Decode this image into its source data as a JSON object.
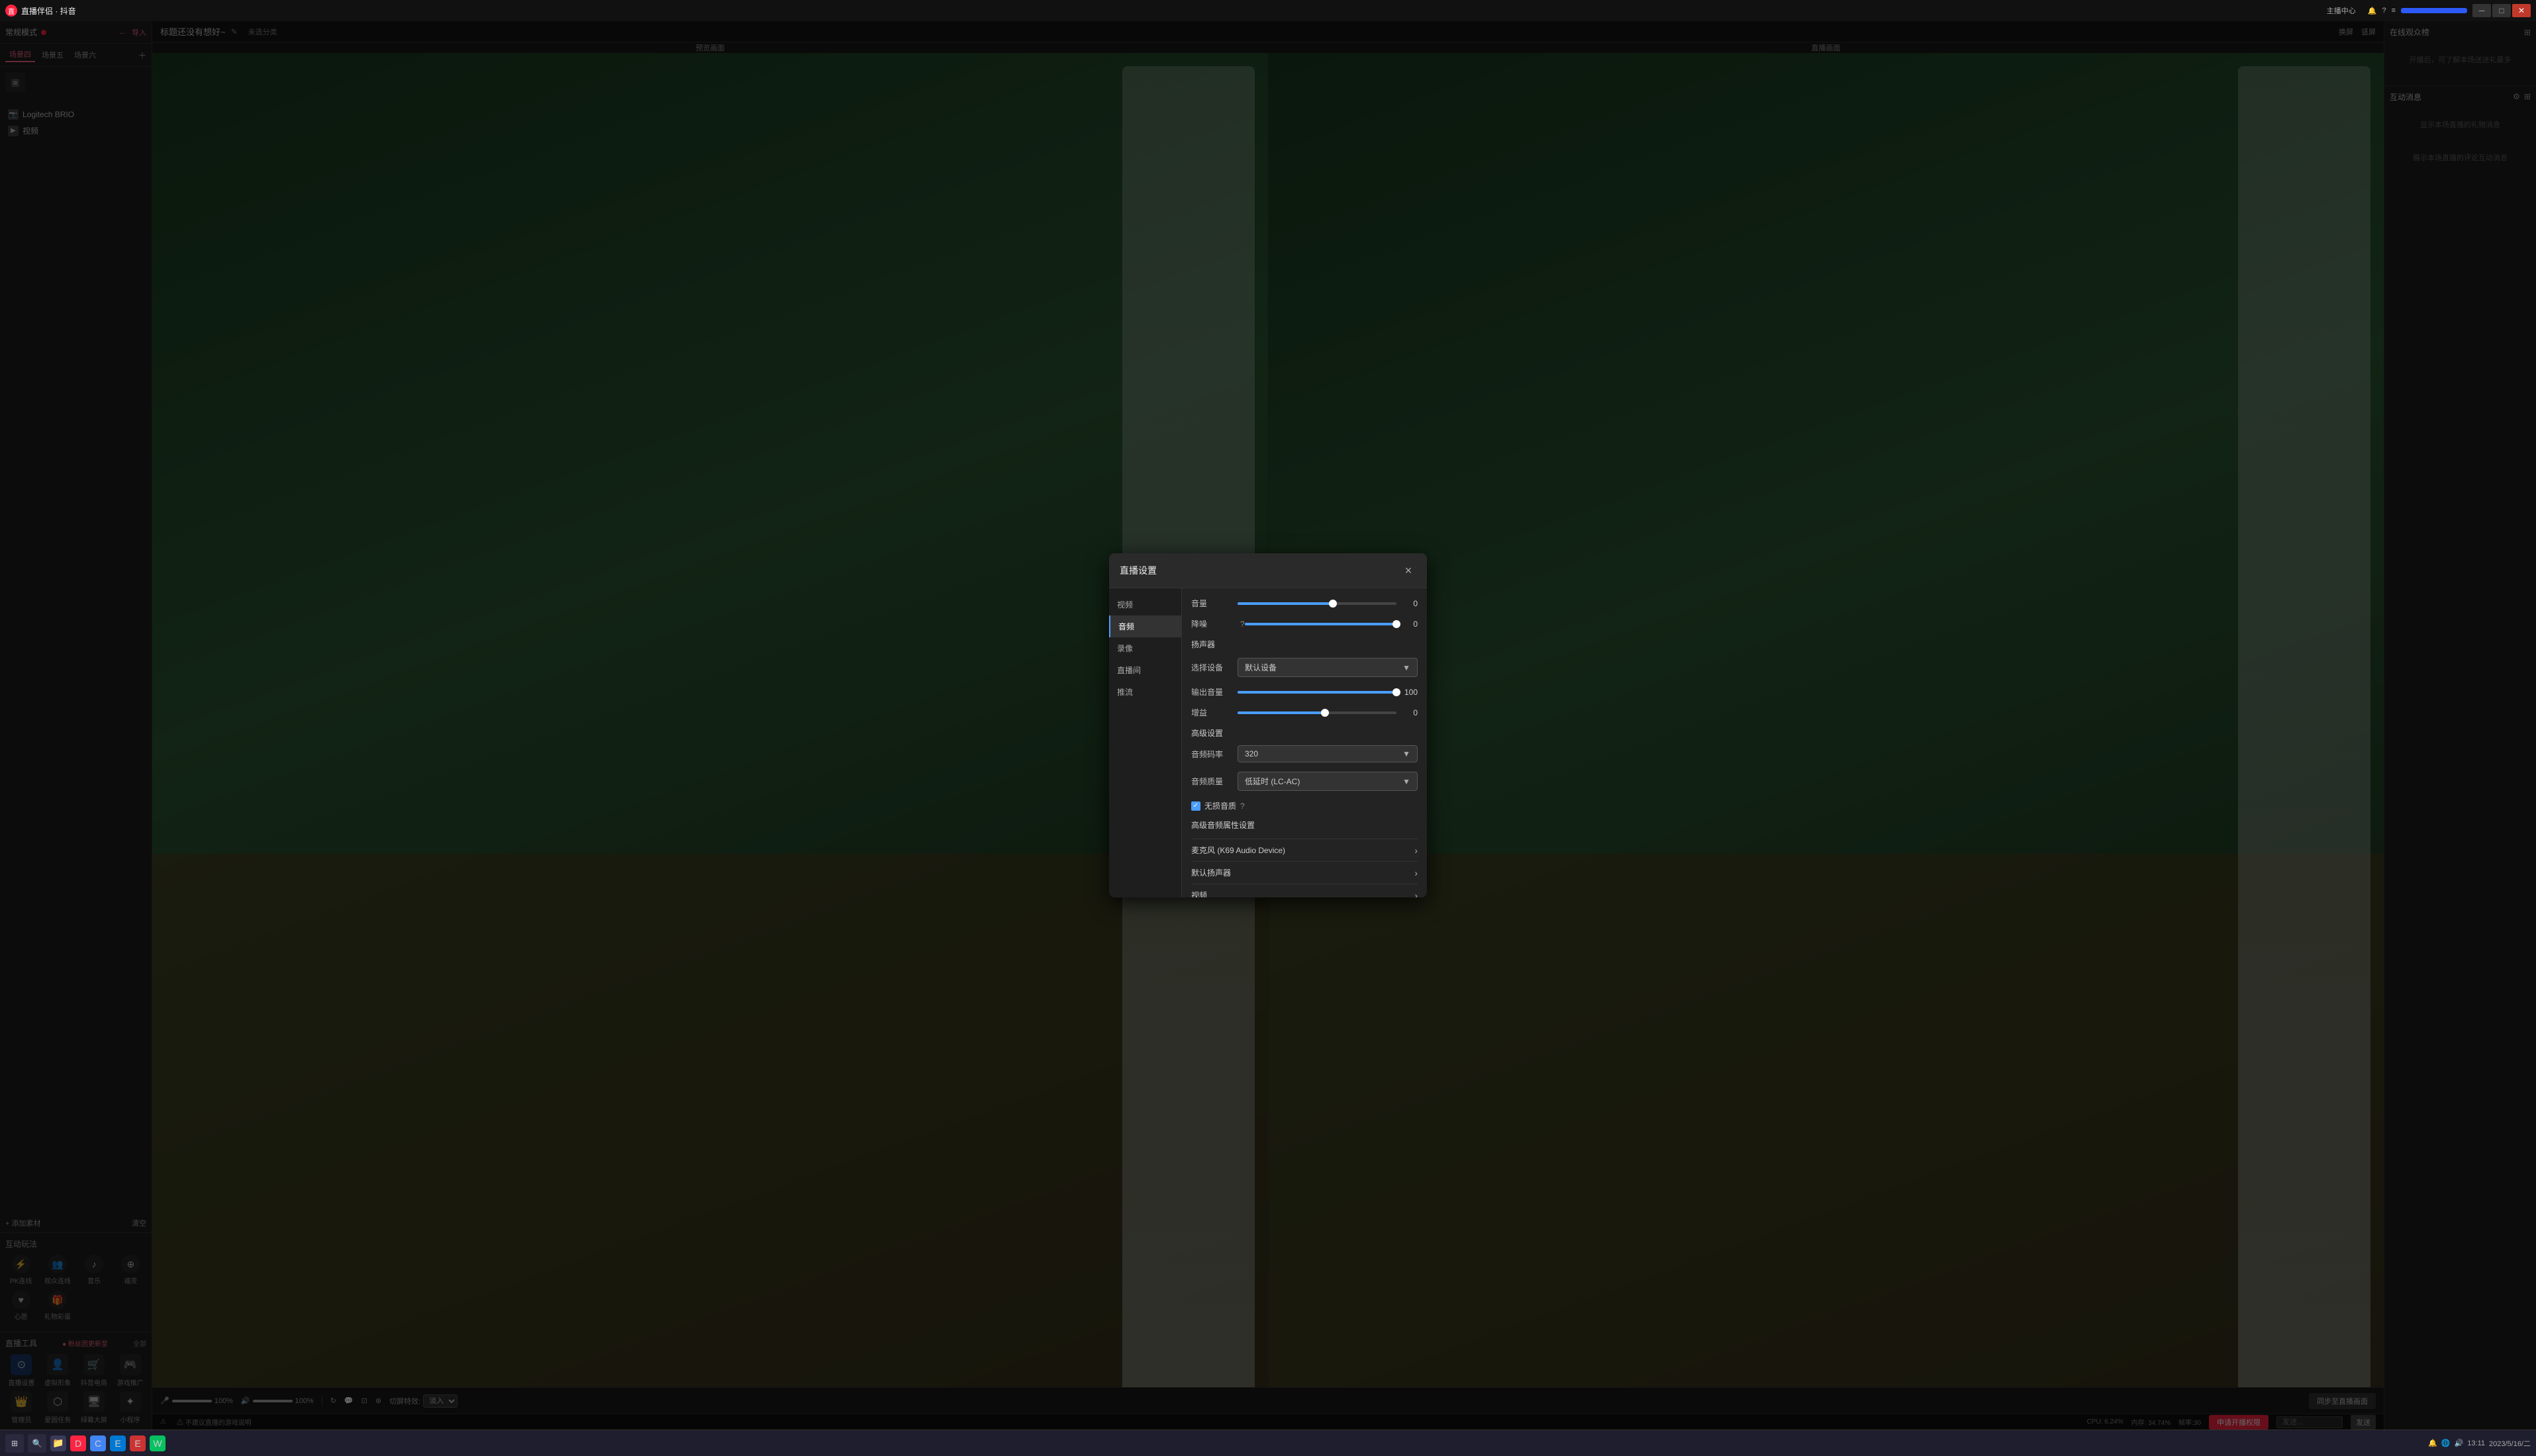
{
  "app": {
    "title": "直播伴侣 · 抖音",
    "logo_text": "直"
  },
  "titlebar": {
    "title": "直播伴侣 · 抖音",
    "host_center": "主播中心",
    "start_label": "",
    "minimize": "─",
    "maximize": "□",
    "close": "✕"
  },
  "sidebar": {
    "mode_label": "常规模式",
    "mode_badge": "●",
    "import_label": "导入",
    "scenes": [
      "场景四",
      "场景五",
      "场景六"
    ],
    "active_scene": "场景四",
    "sources": [
      {
        "label": "Logitech BRIO",
        "type": "camera"
      },
      {
        "label": "视频",
        "type": "video"
      }
    ],
    "add_material": "+ 添加素材",
    "clear": "清空"
  },
  "interactive_tools": {
    "title": "互动玩法",
    "items": [
      {
        "label": "PK连线",
        "icon": "⚡"
      },
      {
        "label": "视众连线",
        "icon": "👥"
      },
      {
        "label": "音乐",
        "icon": "♪"
      },
      {
        "label": "福变",
        "icon": "⊕"
      },
      {
        "label": "心愿",
        "icon": "♥"
      },
      {
        "label": "礼物彩蛋",
        "icon": "🎁"
      }
    ]
  },
  "live_tools": {
    "title": "直播工具",
    "fan_update": "粉丝团更新至",
    "all": "全部",
    "items": [
      {
        "label": "直播设置",
        "icon": "⊙",
        "active": true
      },
      {
        "label": "虚拟形象",
        "icon": "👤"
      },
      {
        "label": "抖音电商",
        "icon": "🛒"
      },
      {
        "label": "游戏推广",
        "icon": "🎮"
      },
      {
        "label": "管理员",
        "icon": "👑"
      },
      {
        "label": "星圆任务",
        "icon": "⬡"
      },
      {
        "label": "绿幕大屏",
        "icon": "🖥"
      },
      {
        "label": "小程序",
        "icon": "✦"
      }
    ]
  },
  "right_panel": {
    "audience": {
      "title": "在线观众榜",
      "expand": "⊞",
      "empty_text": "开播后，可了解本场送送礼最多"
    },
    "interaction": {
      "title": "互动消息",
      "settings_icon": "⚙",
      "expand_icon": "⊞",
      "empty_text": "显示本场直播的礼物消息",
      "footer_text": "展示本场直播的评论互动消息"
    }
  },
  "stream": {
    "title": "标题还没有想好~",
    "subtitle": "未选分类",
    "preview_label": "预览画面",
    "live_label": "直播画面"
  },
  "bottom_controls": {
    "mic_volume": "100%",
    "speaker_volume": "100%",
    "transition_label": "切屏特效:",
    "transition_value": "淡入",
    "sync_btn": "同步至直播画面",
    "warning": "⚠ 不建议直播的游戏说明"
  },
  "status_bar": {
    "cpu": "CPU: 6.24%",
    "memory": "内存: 34.74%",
    "fps": "帧率:30",
    "apply_btn": "申请开播权限",
    "chat_placeholder": "发送..."
  },
  "modal": {
    "title": "直播设置",
    "close": "×",
    "nav_items": [
      "视频",
      "音频",
      "录像",
      "直播间",
      "推流"
    ],
    "active_nav": "音频",
    "sections": {
      "volume": {
        "label": "音量",
        "value": "0",
        "fill_percent": 60
      },
      "noise": {
        "label": "降噪",
        "info_icon": "?",
        "value": "0",
        "fill_percent": 100
      },
      "speaker": {
        "section_label": "扬声器",
        "device_label": "选择设备",
        "device_value": "默认设备",
        "output_label": "输出音量",
        "output_value": "100",
        "output_fill": 100,
        "gain_label": "增益",
        "gain_value": "0",
        "gain_fill": 55
      },
      "advanced": {
        "title": "高级设置",
        "bitrate_label": "音频码率",
        "bitrate_value": "320",
        "quality_label": "音频质量",
        "quality_value": "低延时 (LC-AC)",
        "lossless_label": "无损音质",
        "lossless_checked": true,
        "lossless_help": "?",
        "advanced_audio_title": "高级音频属性设置",
        "mic_label": "麦克风 (K69 Audio Device)",
        "default_speaker_label": "默认扬声器",
        "video_label": "视频"
      }
    }
  },
  "taskbar": {
    "time": "13:11",
    "date": "2023/5/16/二",
    "start_icon": "⊞"
  }
}
